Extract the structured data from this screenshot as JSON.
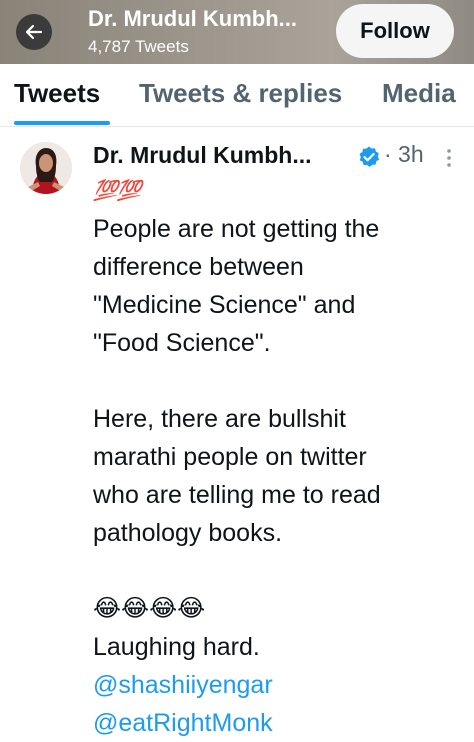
{
  "header": {
    "back_icon": "arrow-left-icon",
    "title": "Dr. Mrudul Kumbh...",
    "tweet_count": "4,787 Tweets",
    "follow_label": "Follow"
  },
  "tabs": [
    {
      "label": "Tweets",
      "active": true
    },
    {
      "label": "Tweets & replies",
      "active": false
    },
    {
      "label": "Media",
      "active": false
    }
  ],
  "tweet": {
    "author": "Dr. Mrudul Kumbh...",
    "verified_icon": "verified-badge-icon",
    "time": "· 3h",
    "more_icon": "more-vertical-icon",
    "hundred_emoji": "💯💯",
    "lines1": [
      "People are not getting the",
      "difference between",
      "\"Medicine Science\" and",
      "\"Food Science\"."
    ],
    "lines2": [
      "Here, there are bullshit",
      "marathi people on twitter",
      "who are telling me to read",
      "pathology books."
    ],
    "emoji_row": "😂😂😂😂",
    "laughing": "Laughing hard.",
    "mentions": [
      "@shashiiyengar",
      "@eatRightMonk"
    ]
  },
  "colors": {
    "accent": "#1d9bf0",
    "text": "#0f1419",
    "muted": "#536471"
  }
}
